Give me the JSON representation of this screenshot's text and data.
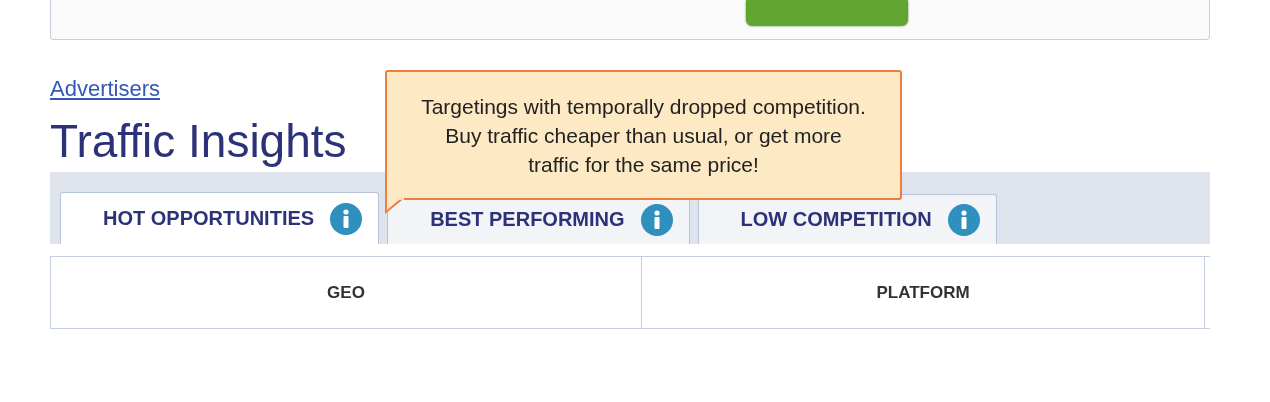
{
  "breadcrumb": {
    "label": "Advertisers"
  },
  "title": "Traffic Insights",
  "tooltip": {
    "text": "Targetings with temporally dropped competition. Buy traffic cheaper than usual, or get more traffic for the same price!"
  },
  "tabs": [
    {
      "label": "HOT OPPORTUNITIES",
      "selected": true
    },
    {
      "label": "BEST PERFORMING",
      "selected": false
    },
    {
      "label": "LOW COMPETITION",
      "selected": false
    }
  ],
  "table": {
    "columns": [
      "GEO",
      "PLATFORM"
    ]
  }
}
